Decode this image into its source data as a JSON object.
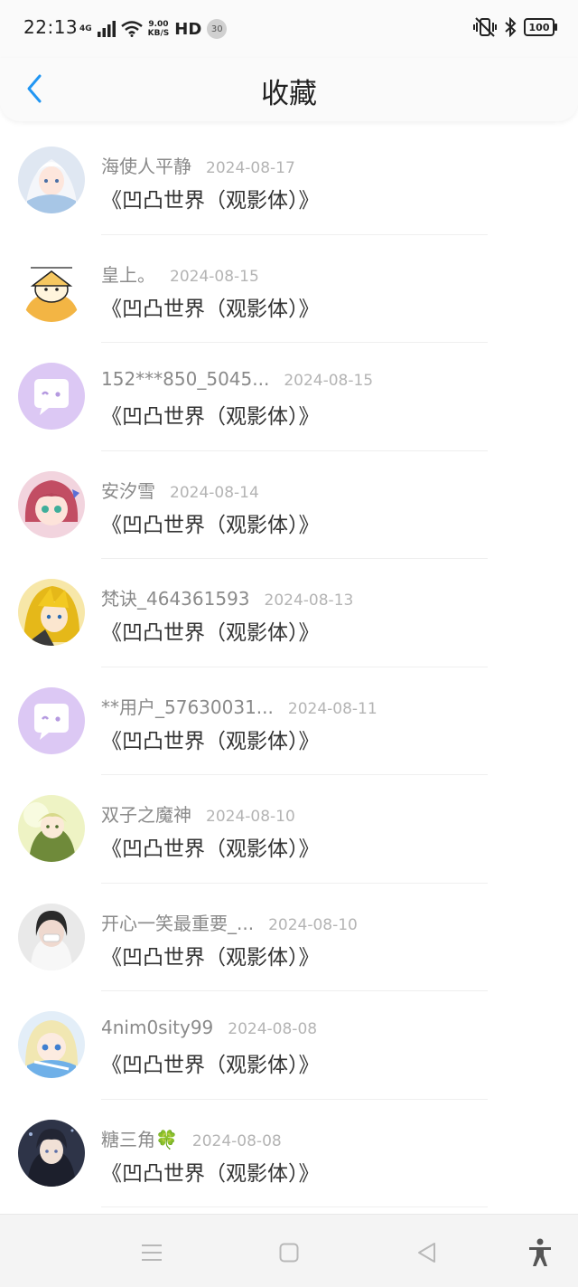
{
  "status_bar": {
    "time": "22:13",
    "network": "4G",
    "speed_value": "9.00",
    "speed_unit": "KB/S",
    "hd": "HD",
    "notification_count": "30",
    "battery": "100"
  },
  "header": {
    "title": "收藏",
    "back_icon": "chevron-left-icon",
    "accent_color": "#2196f3"
  },
  "items": [
    {
      "user": "海使人平静",
      "date": "2024-08-17",
      "work": "《凹凸世界（观影体）》",
      "avatar": "anime-girl-silver"
    },
    {
      "user": "皇上。",
      "date": "2024-08-15",
      "work": "《凹凸世界（观影体）》",
      "avatar": "cartoon-dog"
    },
    {
      "user": "152***850_5045...",
      "date": "2024-08-15",
      "work": "《凹凸世界（观影体）》",
      "avatar": "default-chat"
    },
    {
      "user": "安汐雪",
      "date": "2024-08-14",
      "work": "《凹凸世界（观影体）》",
      "avatar": "anime-girl-pink"
    },
    {
      "user": "梵诀_464361593",
      "date": "2024-08-13",
      "work": "《凹凸世界（观影体）》",
      "avatar": "anime-boy-yellow"
    },
    {
      "user": "**用户_57630031...",
      "date": "2024-08-11",
      "work": "《凹凸世界（观影体）》",
      "avatar": "default-chat"
    },
    {
      "user": "双子之魔神",
      "date": "2024-08-10",
      "work": "《凹凸世界（观影体）》",
      "avatar": "anime-green"
    },
    {
      "user": "开心一笑最重要_...",
      "date": "2024-08-10",
      "work": "《凹凸世界（观影体）》",
      "avatar": "photo-girl"
    },
    {
      "user": "4nim0sity99",
      "date": "2024-08-08",
      "work": "《凹凸世界（观影体）》",
      "avatar": "anime-blue"
    },
    {
      "user": "糖三角🍀",
      "date": "2024-08-08",
      "work": "《凹凸世界（观影体）》",
      "avatar": "anime-dark"
    }
  ],
  "nav_bar": {
    "menu_icon": "menu-icon",
    "home_icon": "home-square-icon",
    "back_icon": "back-triangle-icon",
    "accessibility_icon": "accessibility-icon"
  }
}
